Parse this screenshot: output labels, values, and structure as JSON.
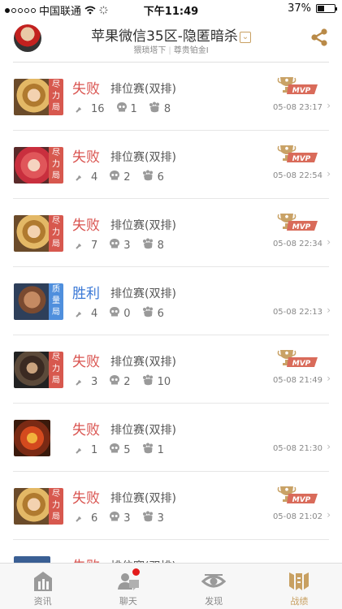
{
  "statusbar": {
    "carrier": "中国联通",
    "time": "下午11:49",
    "battery": "37%"
  },
  "header": {
    "title": "苹果微信35区-隐匿暗杀",
    "subtitle_left": "猥琐塔下",
    "subtitle_sep": "|",
    "subtitle_right": "尊贵铂金I"
  },
  "colors": {
    "lose": "#d9534f",
    "win": "#3a78d6",
    "tag_red": "#d7584e",
    "tag_blue": "#4f8fdd",
    "accent_gold": "#c8a062"
  },
  "matches": [
    {
      "result": "失败",
      "mode": "排位赛(双排)",
      "kills": "16",
      "deaths": "1",
      "assists": "8",
      "time": "05-08 23:17",
      "tag": "尽力局",
      "tag_color": "red",
      "mvp": true,
      "hero": "lady-gold"
    },
    {
      "result": "失败",
      "mode": "排位赛(双排)",
      "kills": "4",
      "deaths": "2",
      "assists": "6",
      "time": "05-08 22:54",
      "tag": "尽力局",
      "tag_color": "red",
      "mvp": true,
      "hero": "pink-hair"
    },
    {
      "result": "失败",
      "mode": "排位赛(双排)",
      "kills": "7",
      "deaths": "3",
      "assists": "8",
      "time": "05-08 22:34",
      "tag": "尽力局",
      "tag_color": "red",
      "mvp": true,
      "hero": "lady-gold"
    },
    {
      "result": "胜利",
      "mode": "排位赛(双排)",
      "kills": "4",
      "deaths": "0",
      "assists": "6",
      "time": "05-08 22:13",
      "tag": "质量局",
      "tag_color": "blue",
      "mvp": false,
      "hero": "bald-warrior"
    },
    {
      "result": "失败",
      "mode": "排位赛(双排)",
      "kills": "3",
      "deaths": "2",
      "assists": "10",
      "time": "05-08 21:49",
      "tag": "尽力局",
      "tag_color": "red",
      "mvp": true,
      "hero": "dark-warrior"
    },
    {
      "result": "失败",
      "mode": "排位赛(双排)",
      "kills": "1",
      "deaths": "5",
      "assists": "1",
      "time": "05-08 21:30",
      "tag": "",
      "tag_color": "",
      "mvp": false,
      "hero": "monkey"
    },
    {
      "result": "失败",
      "mode": "排位赛(双排)",
      "kills": "6",
      "deaths": "3",
      "assists": "3",
      "time": "05-08 21:02",
      "tag": "尽力局",
      "tag_color": "red",
      "mvp": true,
      "hero": "lady-gold"
    },
    {
      "result": "失败",
      "mode": "排位赛(双排)",
      "kills": "",
      "deaths": "",
      "assists": "",
      "time": "",
      "tag": "",
      "tag_color": "",
      "mvp": false,
      "hero": "blue-hero"
    }
  ],
  "mvp_label": "MVP",
  "tabs": [
    {
      "label": "资讯",
      "icon": "news-icon",
      "active": false,
      "badge": false
    },
    {
      "label": "聊天",
      "icon": "chat-icon",
      "active": false,
      "badge": true
    },
    {
      "label": "发现",
      "icon": "discover-eye-icon",
      "active": false,
      "badge": false
    },
    {
      "label": "战绩",
      "icon": "record-icon",
      "active": true,
      "badge": false
    }
  ]
}
